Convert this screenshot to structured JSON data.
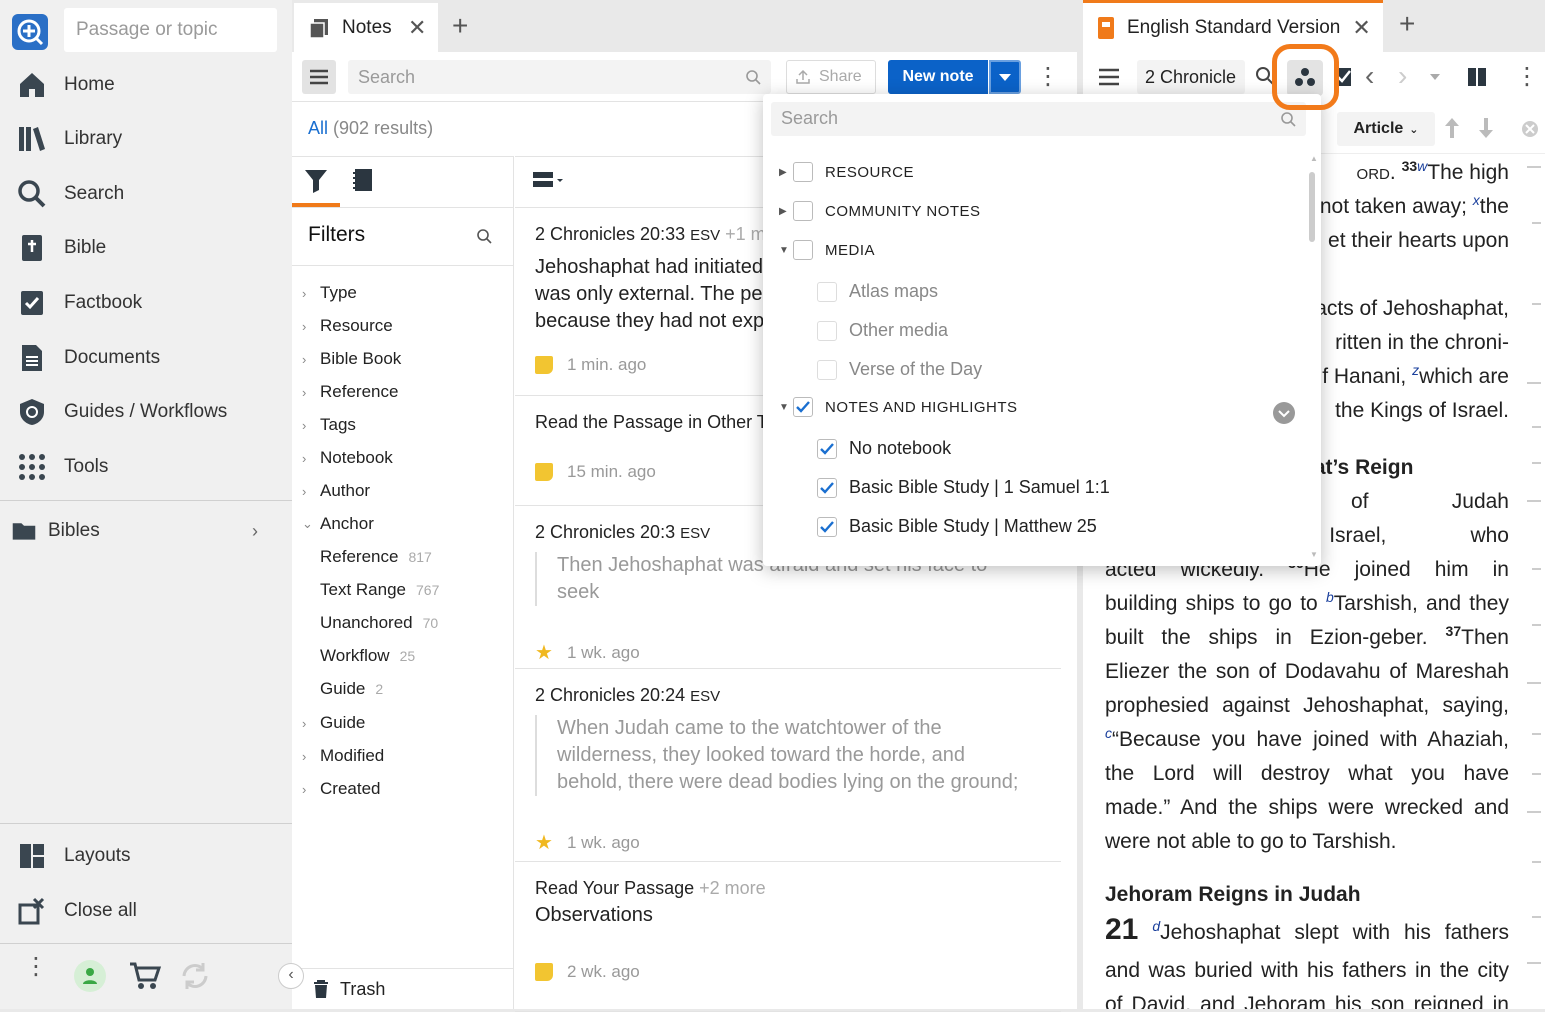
{
  "sidebar": {
    "passage_placeholder": "Passage or topic",
    "nav": [
      "Home",
      "Library",
      "Search",
      "Bible",
      "Factbook",
      "Documents",
      "Guides / Workflows",
      "Tools"
    ],
    "bibles": "Bibles",
    "bottom": [
      "Layouts",
      "Close all"
    ]
  },
  "notes": {
    "tab_label": "Notes",
    "search_placeholder": "Search",
    "share": "Share",
    "new_note": "New note",
    "results_all": "All",
    "results_count": "(902 results)",
    "filters_title": "Filters",
    "filters": [
      {
        "label": "Type"
      },
      {
        "label": "Resource"
      },
      {
        "label": "Bible Book"
      },
      {
        "label": "Reference"
      },
      {
        "label": "Tags"
      },
      {
        "label": "Notebook"
      },
      {
        "label": "Author"
      },
      {
        "label": "Anchor",
        "open": true
      }
    ],
    "anchor_children": [
      {
        "label": "Reference",
        "count": "817"
      },
      {
        "label": "Text Range",
        "count": "767"
      },
      {
        "label": "Unanchored",
        "count": "70"
      },
      {
        "label": "Workflow",
        "count": "25"
      },
      {
        "label": "Guide",
        "count": "2"
      }
    ],
    "filters_after": [
      "Guide",
      "Modified",
      "Created"
    ],
    "trash": "Trash",
    "items": [
      {
        "ref": "2 Chronicles 20:33",
        "ver": "ESV",
        "more": "+1 m",
        "body": "Jehoshaphat had initiated\nwas only external. The pe\nbecause they had not exp",
        "time": "1 min. ago",
        "icon": "sticky"
      },
      {
        "ref": "Read the Passage in Other T",
        "ver": "",
        "more": "",
        "body": "",
        "time": "15 min. ago",
        "icon": "sticky"
      },
      {
        "ref": "2 Chronicles 20:3",
        "ver": "ESV",
        "more": "",
        "quote": "Then Jehoshaphat was afraid and set his face to seek\nthe Lord, and proclaimed a fast throughout all Judah.",
        "time": "1 wk. ago",
        "icon": "star"
      },
      {
        "ref": "2 Chronicles 20:24",
        "ver": "ESV",
        "more": "",
        "quote": "When Judah came to the watchtower of the\nwilderness, they looked toward the horde, and\nbehold, there were dead bodies lying on the ground;",
        "time": "1 wk. ago",
        "icon": "star"
      },
      {
        "ref": "Read Your Passage",
        "ver": "",
        "more": "+2 more",
        "body": "Observations",
        "time": "2 wk. ago",
        "icon": "sticky"
      }
    ]
  },
  "bible": {
    "tab_label": "English Standard Version",
    "chapter": "2 Chronicle",
    "article": "Article",
    "lines": [
      {
        "t": "ord. ",
        "v": "33",
        "f": "w",
        "rest": "The high"
      },
      {
        "plain": "not taken away; ",
        "f": "x",
        "rest": "the"
      },
      {
        "plain": "et their hearts upon"
      },
      {
        "plain": "acts of Jehoshaphat,"
      },
      {
        "plain": "ritten in the chroni-"
      },
      {
        "plain": "f Hanani, ",
        "f": "z",
        "rest": "which are"
      },
      {
        "plain": " the Kings of Israel."
      },
      {
        "plain": "hat’s Reign"
      },
      {
        "plain": "phat king of Judah"
      },
      {
        "plain": "king of Israel, who"
      },
      {
        "plain": "acted wickedly. ",
        "v": "36",
        "rest": "He joined him in"
      },
      {
        "plain": "building ships to go to ",
        "f": "b",
        "rest": "Tarshish, and they"
      },
      {
        "plain": "built the ships in Ezion-geber. ",
        "v": "37",
        "rest": "Then"
      },
      {
        "plain": "Eliezer the son of Dodavahu of Mareshah"
      },
      {
        "plain": "prophesied against Jehoshaphat, saying,"
      },
      {
        "f": "c",
        "rest": "“Because you have joined with Ahaziah,"
      },
      {
        "plain": "the Lord will destroy what you have"
      },
      {
        "plain": "made.” And the ships were wrecked and"
      },
      {
        "plain": "were not able to go to Tarshish."
      }
    ],
    "heading2": "Jehoram Reigns in Judah",
    "chapter_num": "21",
    "ch_fn": "d",
    "ch_line1": "Jehoshaphat slept with his fathers",
    "ch_line2": "and was buried with his fathers in the city",
    "ch_line3": "of David, and Jehoram his son reigned in"
  },
  "dropdown": {
    "search_placeholder": "Search",
    "rows": [
      {
        "type": "cat",
        "label": "RESOURCE",
        "checked": false,
        "arrow": "right"
      },
      {
        "type": "cat",
        "label": "COMMUNITY NOTES",
        "checked": false,
        "arrow": "right"
      },
      {
        "type": "cat",
        "label": "MEDIA",
        "checked": false,
        "arrow": "down"
      },
      {
        "type": "sub",
        "label": "Atlas maps",
        "checked": false,
        "disabled": true
      },
      {
        "type": "sub",
        "label": "Other media",
        "checked": false,
        "disabled": true
      },
      {
        "type": "sub",
        "label": "Verse of the Day",
        "checked": false,
        "disabled": true
      },
      {
        "type": "cat",
        "label": "NOTES AND HIGHLIGHTS",
        "checked": true,
        "arrow": "down"
      },
      {
        "type": "sub",
        "label": "No notebook",
        "checked": true
      },
      {
        "type": "sub",
        "label": "Basic Bible Study | 1 Samuel 1:1",
        "checked": true
      },
      {
        "type": "sub",
        "label": "Basic Bible Study | Matthew 25",
        "checked": true
      }
    ]
  },
  "colors": {
    "accent": "#0b62c8",
    "highlight": "#f27a1a",
    "sticky": "#f2c531",
    "star": "#f0b820"
  }
}
